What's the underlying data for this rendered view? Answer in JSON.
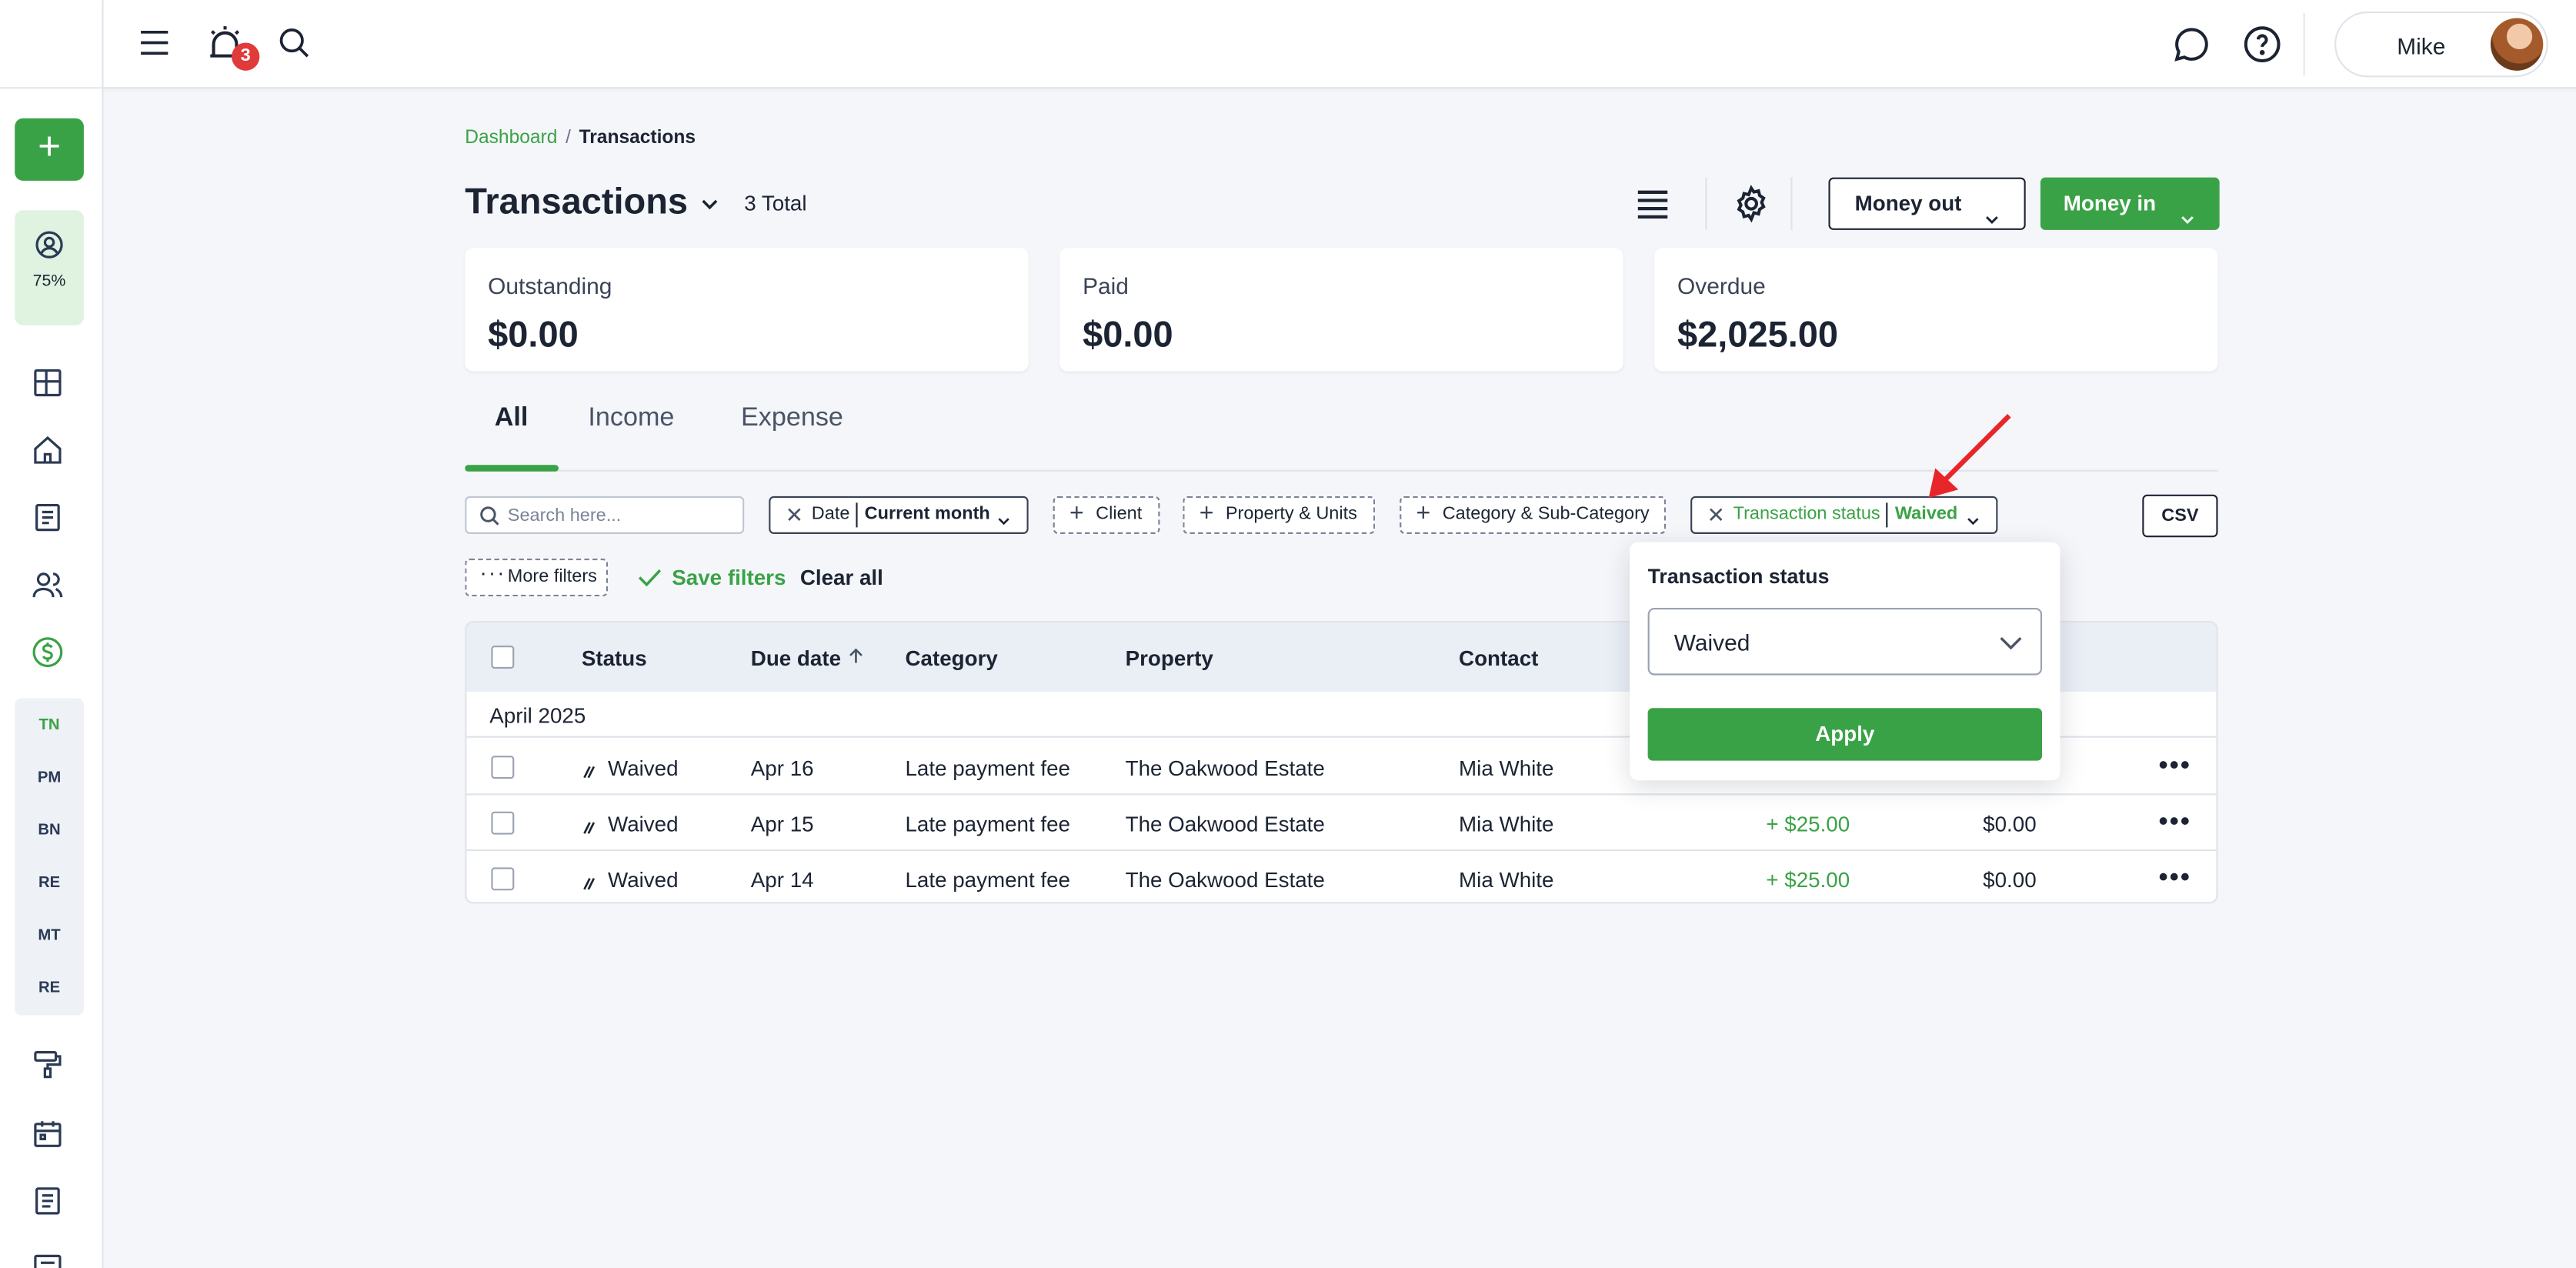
{
  "topbar": {
    "notification_count": "3",
    "user_name": "Mike"
  },
  "sidebar": {
    "progress": "75%",
    "abbreviations": [
      "TN",
      "PM",
      "BN",
      "RE",
      "MT",
      "RE"
    ]
  },
  "breadcrumb": {
    "home": "Dashboard",
    "separator": "/",
    "current": "Transactions"
  },
  "header": {
    "title": "Transactions",
    "total": "3 Total",
    "money_out": "Money out",
    "money_in": "Money in"
  },
  "cards": [
    {
      "label": "Outstanding",
      "value": "$0.00"
    },
    {
      "label": "Paid",
      "value": "$0.00"
    },
    {
      "label": "Overdue",
      "value": "$2,025.00"
    }
  ],
  "tabs": [
    "All",
    "Income",
    "Expense"
  ],
  "filters": {
    "search_placeholder": "Search here...",
    "date_label": "Date",
    "date_value": "Current month",
    "client": "Client",
    "property_units": "Property & Units",
    "category": "Category & Sub-Category",
    "status_label": "Transaction status",
    "status_value": "Waived",
    "csv": "CSV",
    "more_filters": "More filters",
    "save_filters": "Save filters",
    "clear_all": "Clear all"
  },
  "table": {
    "headers": {
      "status": "Status",
      "due_date": "Due date",
      "category": "Category",
      "property": "Property",
      "contact": "Contact"
    },
    "group": "April 2025",
    "rows": [
      {
        "status": "Waived",
        "due": "Apr 16",
        "category": "Late payment fee",
        "property": "The Oakwood Estate",
        "contact": "Mia White",
        "amount": "",
        "balance": ""
      },
      {
        "status": "Waived",
        "due": "Apr 15",
        "category": "Late payment fee",
        "property": "The Oakwood Estate",
        "contact": "Mia White",
        "amount": "+ $25.00",
        "balance": "$0.00"
      },
      {
        "status": "Waived",
        "due": "Apr 14",
        "category": "Late payment fee",
        "property": "The Oakwood Estate",
        "contact": "Mia White",
        "amount": "+ $25.00",
        "balance": "$0.00"
      }
    ]
  },
  "popover": {
    "title": "Transaction status",
    "selected": "Waived",
    "apply": "Apply"
  },
  "colors": {
    "accent": "#3aa246",
    "badge": "#e03a3a",
    "annotation_arrow": "#e8262a"
  }
}
